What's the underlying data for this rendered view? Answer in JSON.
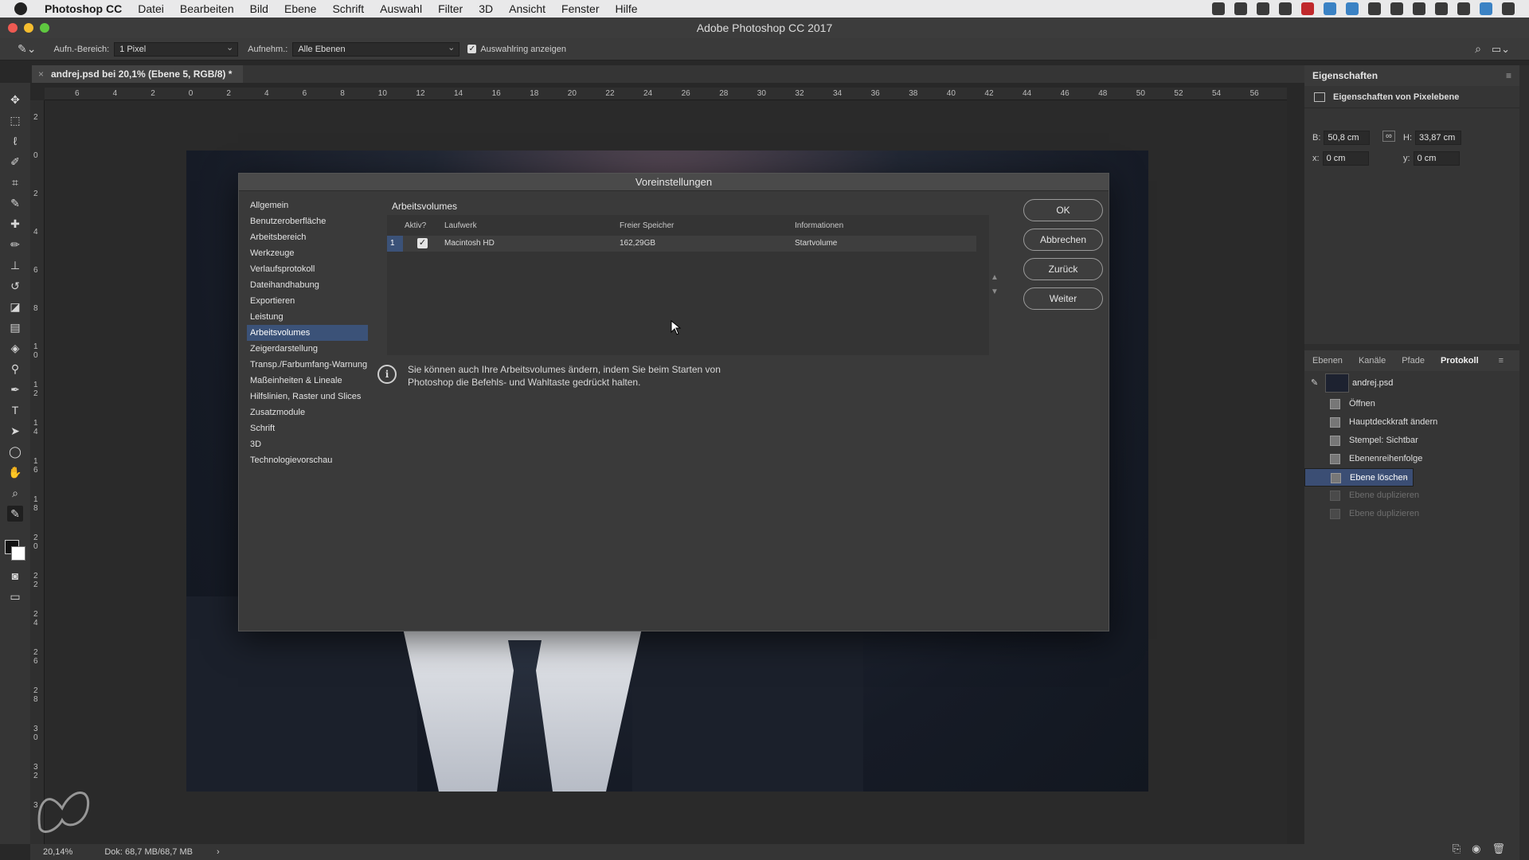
{
  "menubar": {
    "app": "Photoshop CC",
    "items": [
      "Datei",
      "Bearbeiten",
      "Bild",
      "Ebene",
      "Schrift",
      "Auswahl",
      "Filter",
      "3D",
      "Ansicht",
      "Fenster",
      "Hilfe"
    ]
  },
  "window": {
    "title": "Adobe Photoshop CC 2017"
  },
  "options": {
    "sample_size_label": "Aufn.-Bereich:",
    "sample_size_value": "1 Pixel",
    "sample_label": "Aufnehm.:",
    "sample_value": "Alle Ebenen",
    "show_ring_label": "Auswahlring anzeigen"
  },
  "document": {
    "tab_title": "andrej.psd bei 20,1% (Ebene 5, RGB/8) *"
  },
  "ruler": {
    "top": [
      "6",
      "4",
      "2",
      "0",
      "2",
      "4",
      "6",
      "8",
      "10",
      "12",
      "14",
      "16",
      "18",
      "20",
      "22",
      "24",
      "26",
      "28",
      "30",
      "32",
      "34",
      "36",
      "38",
      "40",
      "42",
      "44",
      "46",
      "48",
      "50",
      "52",
      "54",
      "56"
    ],
    "left": [
      "2",
      "0",
      "2",
      "4",
      "6",
      "8",
      "1 0",
      "1 2",
      "1 4",
      "1 6",
      "1 8",
      "2 0",
      "2 2",
      "2 4",
      "2 6",
      "2 8",
      "3 0",
      "3 2",
      "3"
    ]
  },
  "status": {
    "zoom": "20,14%",
    "doc": "Dok: 68,7 MB/68,7 MB"
  },
  "properties": {
    "title": "Eigenschaften",
    "subtitle": "Eigenschaften von Pixelebene",
    "b_label": "B:",
    "b_value": "50,8 cm",
    "h_label": "H:",
    "h_value": "33,87 cm",
    "x_label": "x:",
    "x_value": "0 cm",
    "y_label": "y:",
    "y_value": "0 cm"
  },
  "history": {
    "tabs": [
      "Ebenen",
      "Kanäle",
      "Pfade",
      "Protokoll"
    ],
    "active_tab": "Protokoll",
    "snapshot": "andrej.psd",
    "states": [
      {
        "label": "Öffnen",
        "state": "normal"
      },
      {
        "label": "Hauptdeckkraft ändern",
        "state": "normal"
      },
      {
        "label": "Stempel: Sichtbar",
        "state": "normal"
      },
      {
        "label": "Ebenenreihenfolge",
        "state": "normal"
      },
      {
        "label": "Ebene löschen",
        "state": "selected"
      },
      {
        "label": "Ebene duplizieren",
        "state": "dim"
      },
      {
        "label": "Ebene duplizieren",
        "state": "dim"
      }
    ]
  },
  "dialog": {
    "title": "Voreinstellungen",
    "nav": [
      "Allgemein",
      "Benutzeroberfläche",
      "Arbeitsbereich",
      "Werkzeuge",
      "Verlaufsprotokoll",
      "Dateihandhabung",
      "Exportieren",
      "Leistung",
      "Arbeitsvolumes",
      "Zeigerdarstellung",
      "Transp./Farbumfang-Warnung",
      "Maßeinheiten & Lineale",
      "Hilfslinien, Raster und Slices",
      "Zusatzmodule",
      "Schrift",
      "3D",
      "Technologievorschau"
    ],
    "nav_selected": "Arbeitsvolumes",
    "section_title": "Arbeitsvolumes",
    "columns": {
      "active": "Aktiv?",
      "drive": "Laufwerk",
      "free": "Freier Speicher",
      "info": "Informationen"
    },
    "rows": [
      {
        "index": "1",
        "active": true,
        "drive": "Macintosh HD",
        "free": "162,29GB",
        "info": "Startvolume"
      }
    ],
    "info_text_1": "Sie können auch Ihre Arbeitsvolumes ändern, indem Sie beim Starten von",
    "info_text_2": "Photoshop die Befehls- und Wahltaste gedrückt halten.",
    "buttons": {
      "ok": "OK",
      "cancel": "Abbrechen",
      "back": "Zurück",
      "next": "Weiter"
    }
  },
  "colors": {
    "selection": "#3b5278",
    "panel_bg": "#353535",
    "dialog_bg": "#3a3a3a"
  }
}
